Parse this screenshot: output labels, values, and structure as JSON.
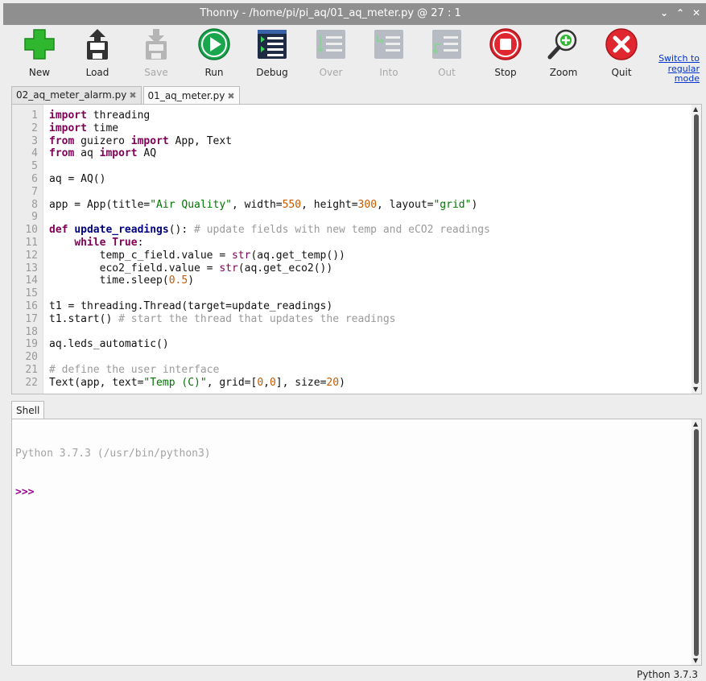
{
  "window": {
    "title": "Thonny  -  /home/pi/pi_aq/01_aq_meter.py  @  27 : 1",
    "controls": [
      "⌄",
      "⌃",
      "✕"
    ]
  },
  "toolbar": {
    "buttons": [
      {
        "label": "New",
        "icon": "new-file-icon",
        "enabled": true
      },
      {
        "label": "Load",
        "icon": "load-icon",
        "enabled": true
      },
      {
        "label": "Save",
        "icon": "save-icon",
        "enabled": false
      },
      {
        "label": "Run",
        "icon": "run-icon",
        "enabled": true
      },
      {
        "label": "Debug",
        "icon": "debug-icon",
        "enabled": true
      },
      {
        "label": "Over",
        "icon": "step-over-icon",
        "enabled": false
      },
      {
        "label": "Into",
        "icon": "step-into-icon",
        "enabled": false
      },
      {
        "label": "Out",
        "icon": "step-out-icon",
        "enabled": false
      },
      {
        "label": "Stop",
        "icon": "stop-icon",
        "enabled": true
      },
      {
        "label": "Zoom",
        "icon": "zoom-icon",
        "enabled": true
      },
      {
        "label": "Quit",
        "icon": "quit-icon",
        "enabled": true
      }
    ],
    "switch_mode": [
      "Switch to",
      "regular",
      "mode"
    ]
  },
  "editor": {
    "tabs": [
      {
        "name": "02_aq_meter_alarm.py",
        "close": "✖",
        "active": false
      },
      {
        "name": "01_aq_meter.py",
        "close": "✖",
        "active": true
      }
    ],
    "lines": [
      {
        "n": "1",
        "tokens": [
          [
            "kw",
            "import"
          ],
          [
            "",
            "threading"
          ]
        ]
      },
      {
        "n": "2",
        "tokens": [
          [
            "kw",
            "import"
          ],
          [
            "",
            "time"
          ]
        ]
      },
      {
        "n": "3",
        "tokens": [
          [
            "kw",
            "from"
          ],
          [
            "",
            " guizero "
          ],
          [
            "kw",
            "import"
          ],
          [
            "",
            " App, Text"
          ]
        ]
      },
      {
        "n": "4",
        "tokens": [
          [
            "kw",
            "from"
          ],
          [
            "",
            " aq "
          ],
          [
            "kw",
            "import"
          ],
          [
            "",
            " AQ"
          ]
        ]
      },
      {
        "n": "5",
        "tokens": []
      },
      {
        "n": "6",
        "tokens": [
          [
            "",
            "aq = AQ()"
          ]
        ]
      },
      {
        "n": "7",
        "tokens": []
      },
      {
        "n": "8",
        "tokens": [
          [
            "",
            "app = App(title="
          ],
          [
            "str",
            "\"Air Quality\""
          ],
          [
            "",
            ", width="
          ],
          [
            "num",
            "550"
          ],
          [
            "",
            ", height="
          ],
          [
            "num",
            "300"
          ],
          [
            "",
            ", layout="
          ],
          [
            "str",
            "\"grid\""
          ],
          [
            "",
            ")"
          ]
        ]
      },
      {
        "n": "9",
        "tokens": []
      },
      {
        "n": "10",
        "tokens": [
          [
            "kw",
            "def"
          ],
          [
            "",
            " "
          ],
          [
            "fn",
            "update_readings"
          ],
          [
            "",
            "(): "
          ],
          [
            "cm",
            "# update fields with new temp and eCO2 readings"
          ]
        ]
      },
      {
        "n": "11",
        "tokens": [
          [
            "",
            "    "
          ],
          [
            "kw",
            "while"
          ],
          [
            "",
            " "
          ],
          [
            "kw",
            "True"
          ],
          [
            "",
            ":"
          ]
        ]
      },
      {
        "n": "12",
        "tokens": [
          [
            "",
            "        temp_c_field.value = "
          ],
          [
            "bi",
            "str"
          ],
          [
            "",
            "(aq.get_temp())"
          ]
        ]
      },
      {
        "n": "13",
        "tokens": [
          [
            "",
            "        eco2_field.value = "
          ],
          [
            "bi",
            "str"
          ],
          [
            "",
            "(aq.get_eco2())"
          ]
        ]
      },
      {
        "n": "14",
        "tokens": [
          [
            "",
            "        time.sleep("
          ],
          [
            "num",
            "0.5"
          ],
          [
            "",
            ")"
          ]
        ]
      },
      {
        "n": "15",
        "tokens": []
      },
      {
        "n": "16",
        "tokens": [
          [
            "",
            "t1 = threading.Thread(target=update_readings)"
          ]
        ]
      },
      {
        "n": "17",
        "tokens": [
          [
            "",
            "t1.start() "
          ],
          [
            "cm",
            "# start the thread that updates the readings"
          ]
        ]
      },
      {
        "n": "18",
        "tokens": []
      },
      {
        "n": "19",
        "tokens": [
          [
            "",
            "aq.leds_automatic()"
          ]
        ]
      },
      {
        "n": "20",
        "tokens": []
      },
      {
        "n": "21",
        "tokens": [
          [
            "cm",
            "# define the user interface"
          ]
        ]
      },
      {
        "n": "22",
        "tokens": [
          [
            "",
            "Text(app, text="
          ],
          [
            "str",
            "\"Temp (C)\""
          ],
          [
            "",
            ", grid=["
          ],
          [
            "num",
            "0"
          ],
          [
            "",
            ","
          ],
          [
            "num",
            "0"
          ],
          [
            "",
            "], size="
          ],
          [
            "num",
            "20"
          ],
          [
            "",
            ")"
          ]
        ]
      }
    ],
    "scroll_position": 0.0
  },
  "shell": {
    "tab_label": "Shell",
    "version_line": "Python 3.7.3 (/usr/bin/python3)",
    "prompt": ">>>"
  },
  "status": {
    "interpreter": "Python 3.7.3"
  },
  "colors": {
    "keyword": "#7f0055",
    "string": "#007700",
    "number": "#c35a00",
    "comment": "#9a9a9a",
    "prompt": "#9b0090"
  }
}
